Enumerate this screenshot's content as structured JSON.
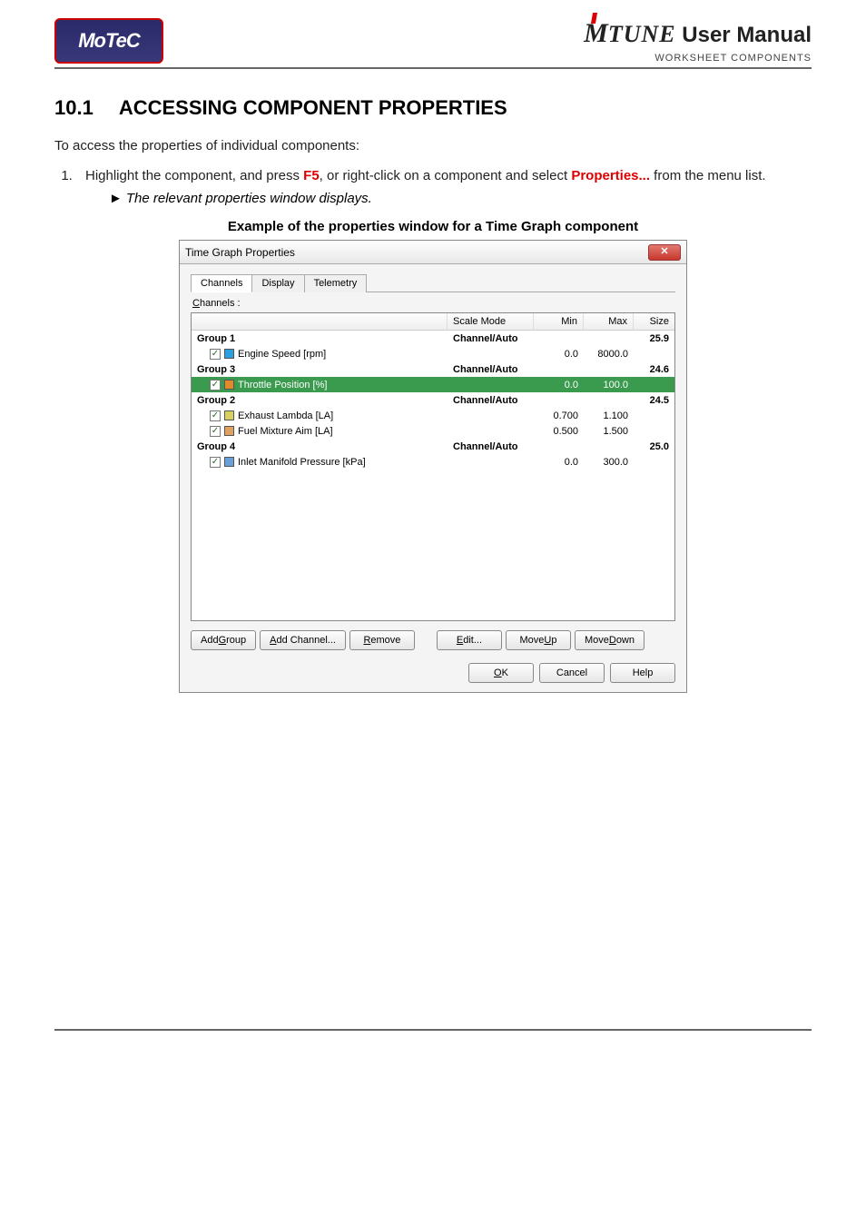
{
  "header": {
    "logo_text": "MoTeC",
    "brand_m": "M",
    "brand_tune": "TUNE",
    "brand_suffix": " User Manual",
    "subheader": "WORKSHEET COMPONENTS"
  },
  "section": {
    "number": "10.1",
    "title": "ACCESSING COMPONENT PROPERTIES"
  },
  "intro": "To access the properties of individual components:",
  "step1_a": "Highlight the component, and press ",
  "step1_f5": "F5",
  "step1_b": ", or right-click on a component and select ",
  "step1_props": "Properties...",
  "step1_c": " from the menu list.",
  "result_tri": "►",
  "result_text": "The relevant properties window displays.",
  "caption": "Example of the properties window for a Time Graph component",
  "dialog": {
    "title": "Time Graph Properties",
    "close": "✕",
    "tabs": [
      "Channels",
      "Display",
      "Telemetry"
    ],
    "channels_label_pre": "C",
    "channels_label_post": "hannels :",
    "cols": {
      "name": "",
      "scale": "Scale Mode",
      "min": "Min",
      "max": "Max",
      "size": "Size"
    },
    "rows": [
      {
        "type": "group",
        "name": "Group 1",
        "scale": "Channel/Auto",
        "min": "",
        "max": "",
        "size": "25.9"
      },
      {
        "type": "chan",
        "name": "Engine Speed [rpm]",
        "min": "0.0",
        "max": "8000.0",
        "color": "#2aa0e0"
      },
      {
        "type": "group",
        "name": "Group 3",
        "scale": "Channel/Auto",
        "min": "",
        "max": "",
        "size": "24.6"
      },
      {
        "type": "chan",
        "name": "Throttle Position [%]",
        "min": "0.0",
        "max": "100.0",
        "color": "#e08a2a",
        "sel": true
      },
      {
        "type": "group",
        "name": "Group 2",
        "scale": "Channel/Auto",
        "min": "",
        "max": "",
        "size": "24.5"
      },
      {
        "type": "chan",
        "name": "Exhaust Lambda [LA]",
        "min": "0.700",
        "max": "1.100",
        "color": "#d8d060"
      },
      {
        "type": "chan",
        "name": "Fuel Mixture Aim [LA]",
        "min": "0.500",
        "max": "1.500",
        "color": "#e0a060"
      },
      {
        "type": "group",
        "name": "Group 4",
        "scale": "Channel/Auto",
        "min": "",
        "max": "",
        "size": "25.0"
      },
      {
        "type": "chan",
        "name": "Inlet Manifold Pressure [kPa]",
        "min": "0.0",
        "max": "300.0",
        "color": "#6aa0d8"
      }
    ],
    "buttons_row1": {
      "add_group": "Add Group",
      "add_channel": "Add Channel...",
      "remove": "Remove",
      "edit": "Edit...",
      "move_up": "Move Up",
      "move_down": "Move Down"
    },
    "buttons_row2": {
      "ok": "OK",
      "cancel": "Cancel",
      "help": "Help"
    },
    "underlines": {
      "add_group": "G",
      "add_channel": "A",
      "remove": "R",
      "edit": "E",
      "move_up": "U",
      "move_down": "D",
      "ok": "O"
    }
  }
}
